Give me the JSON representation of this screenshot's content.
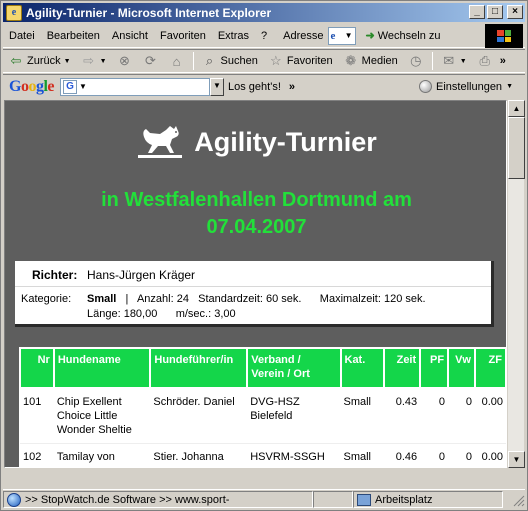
{
  "window": {
    "title": "Agility-Turnier - Microsoft Internet Explorer",
    "buttons": {
      "minimize": "_",
      "maximize": "□",
      "close": "×"
    }
  },
  "menubar": {
    "items": [
      "Datei",
      "Bearbeiten",
      "Ansicht",
      "Favoriten",
      "Extras",
      "?"
    ],
    "address_label": "Adresse",
    "go_label": "Wechseln zu"
  },
  "toolbar": {
    "back": "Zurück",
    "search": "Suchen",
    "favorites": "Favoriten",
    "media": "Medien"
  },
  "googlebar": {
    "logo": [
      "G",
      "o",
      "o",
      "g",
      "l",
      "e"
    ],
    "search_value": "",
    "go_label": "Los geht's!",
    "more": "»",
    "settings_label": "Einstellungen"
  },
  "page": {
    "title": "Agility-Turnier",
    "subtitle_line1": "in Westfalenhallen Dortmund am",
    "subtitle_line2": "07.04.2007",
    "judge_label": "Richter:",
    "judge_name": "Hans-Jürgen Kräger",
    "category_label": "Kategorie:",
    "category_value": "Small",
    "category_sep": "|",
    "count": "Anzahl: 24",
    "standard_time": "Standardzeit: 60 sek.",
    "max_time": "Maximalzeit: 120 sek.",
    "length": "Länge: 180,00",
    "speed": "m/sec.: 3,00"
  },
  "table": {
    "headers": [
      "Nr",
      "Hundename",
      "Hundeführer/in",
      "Verband / Verein / Ort",
      "Kat.",
      "Zeit",
      "PF",
      "Vw",
      "ZF"
    ],
    "rows": [
      [
        "101",
        "Chip Exellent Choice Little Wonder Sheltie",
        "Schröder. Daniel",
        "DVG-HSZ Bielefeld",
        "Small",
        "0.43",
        "0",
        "0",
        "0.00"
      ],
      [
        "102",
        "Tamilay von",
        "Stier. Johanna",
        "HSVRM-SSGH",
        "Small",
        "0.46",
        "0",
        "0",
        "0.00"
      ]
    ]
  },
  "statusbar": {
    "text": ">> StopWatch.de Software >> www.sport-",
    "zone": "Arbeitsplatz"
  }
}
